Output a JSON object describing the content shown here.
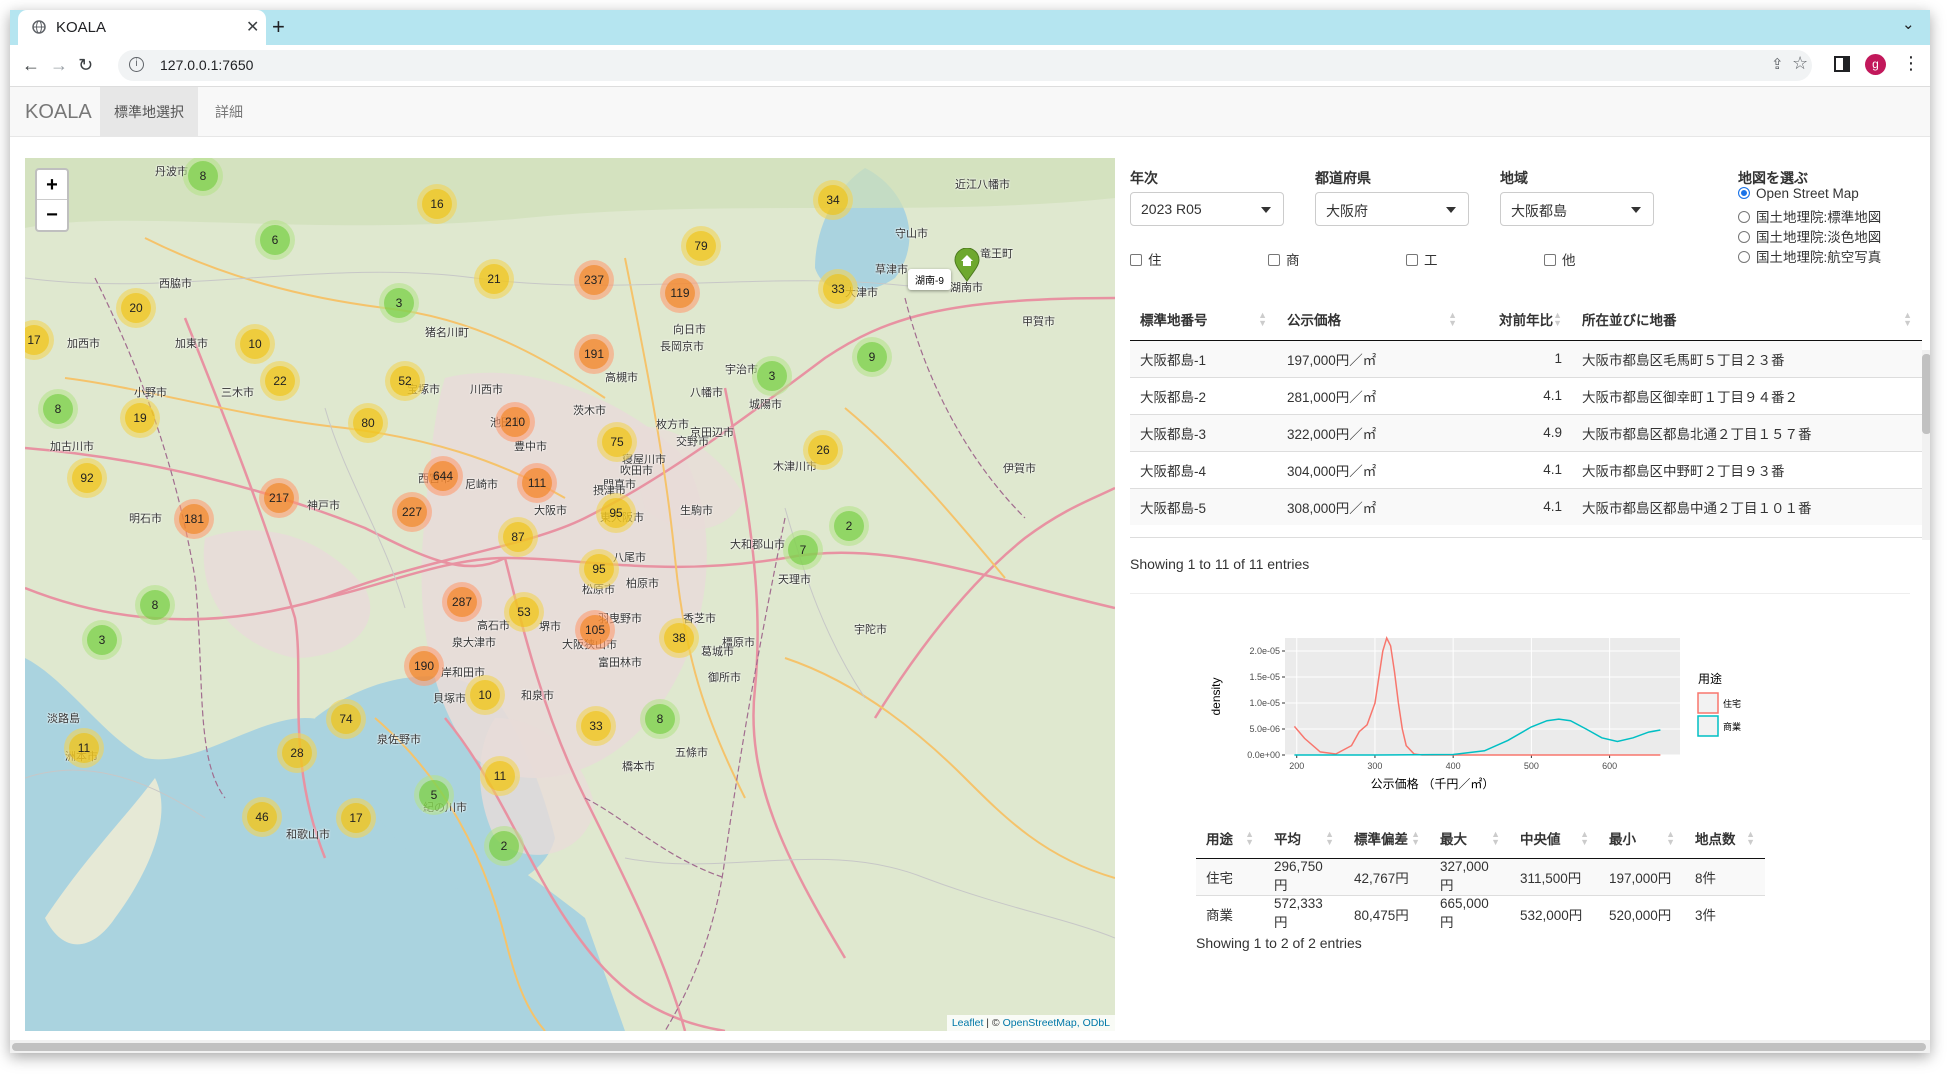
{
  "browser": {
    "tab_title": "KOALA",
    "url": "127.0.0.1:7650",
    "profile_initial": "g"
  },
  "app": {
    "brand": "KOALA",
    "nav": [
      "標準地選択",
      "詳細"
    ]
  },
  "map": {
    "attribution_leaflet": "Leaflet",
    "attribution_sep": " | © ",
    "attribution_osm": "OpenStreetMap",
    "attribution_odbl": ", ODbL",
    "tooltip": "湖南-9",
    "clusters": [
      {
        "n": "8",
        "c": "g"
      },
      {
        "n": "16",
        "c": "y"
      },
      {
        "n": "6",
        "c": "g"
      },
      {
        "n": "20",
        "c": "y"
      },
      {
        "n": "3",
        "c": "g"
      },
      {
        "n": "21",
        "c": "y"
      },
      {
        "n": "237",
        "c": "o"
      },
      {
        "n": "119",
        "c": "o"
      },
      {
        "n": "79",
        "c": "y"
      },
      {
        "n": "34",
        "c": "y"
      },
      {
        "n": "33",
        "c": "y"
      },
      {
        "n": "17",
        "c": "y"
      },
      {
        "n": "10",
        "c": "y"
      },
      {
        "n": "22",
        "c": "y"
      },
      {
        "n": "52",
        "c": "y"
      },
      {
        "n": "191",
        "c": "o"
      },
      {
        "n": "3",
        "c": "g"
      },
      {
        "n": "9",
        "c": "g"
      },
      {
        "n": "8",
        "c": "g"
      },
      {
        "n": "19",
        "c": "y"
      },
      {
        "n": "80",
        "c": "y"
      },
      {
        "n": "210",
        "c": "o"
      },
      {
        "n": "75",
        "c": "y"
      },
      {
        "n": "26",
        "c": "y"
      },
      {
        "n": "92",
        "c": "y"
      },
      {
        "n": "644",
        "c": "o"
      },
      {
        "n": "111",
        "c": "o"
      },
      {
        "n": "217",
        "c": "o"
      },
      {
        "n": "227",
        "c": "o"
      },
      {
        "n": "95",
        "c": "y"
      },
      {
        "n": "181",
        "c": "o"
      },
      {
        "n": "87",
        "c": "y"
      },
      {
        "n": "2",
        "c": "g"
      },
      {
        "n": "7",
        "c": "g"
      },
      {
        "n": "95",
        "c": "y"
      },
      {
        "n": "8",
        "c": "g"
      },
      {
        "n": "287",
        "c": "o"
      },
      {
        "n": "53",
        "c": "y"
      },
      {
        "n": "105",
        "c": "o"
      },
      {
        "n": "38",
        "c": "y"
      },
      {
        "n": "3",
        "c": "g"
      },
      {
        "n": "190",
        "c": "o"
      },
      {
        "n": "10",
        "c": "y"
      },
      {
        "n": "74",
        "c": "y"
      },
      {
        "n": "8",
        "c": "g"
      },
      {
        "n": "33",
        "c": "y"
      },
      {
        "n": "28",
        "c": "y"
      },
      {
        "n": "11",
        "c": "y"
      },
      {
        "n": "11",
        "c": "y"
      },
      {
        "n": "5",
        "c": "g"
      },
      {
        "n": "46",
        "c": "y"
      },
      {
        "n": "17",
        "c": "y"
      },
      {
        "n": "2",
        "c": "g"
      }
    ],
    "places": [
      "丹波市",
      "近江八幡市",
      "守山市",
      "草津市",
      "竜王町",
      "湖南市",
      "大津市",
      "甲賀市",
      "西脇市",
      "加西市",
      "加東市",
      "小野市",
      "三木市",
      "猪名川町",
      "宝塚市",
      "川西市",
      "池田市",
      "豊中市",
      "茨木市",
      "高槻市",
      "長岡京市",
      "向日市",
      "宇治市",
      "八幡市",
      "城陽市",
      "枚方市",
      "交野市",
      "寝屋川市",
      "京田辺市",
      "木津川市",
      "伊賀市",
      "加古川市",
      "明石市",
      "神戸市",
      "西宮市",
      "尼崎市",
      "大阪市",
      "門真市",
      "東大阪市",
      "生駒市",
      "八尾市",
      "大和郡山市",
      "天理市",
      "柏原市",
      "香芝市",
      "橿原市",
      "葛城市",
      "御所市",
      "宇陀市",
      "松原市",
      "堺市",
      "羽曳野市",
      "大阪狭山市",
      "富田林市",
      "泉大津市",
      "岸和田市",
      "和泉市",
      "貝塚市",
      "泉佐野市",
      "五條市",
      "淡路島",
      "洲本市",
      "和歌山市",
      "紀の川市",
      "橋本市",
      "摂津市",
      "吹田市",
      "高石市"
    ]
  },
  "filters": {
    "year_label": "年次",
    "year_value": "2023 R05",
    "pref_label": "都道府県",
    "pref_value": "大阪府",
    "region_label": "地域",
    "region_value": "大阪都島",
    "map_label": "地図を選ぶ",
    "map_options": [
      "Open Street Map",
      "国土地理院:標準地図",
      "国土地理院:淡色地図",
      "国土地理院:航空写真"
    ],
    "map_selected": 0,
    "use_checks": [
      "住",
      "商",
      "工",
      "他"
    ]
  },
  "table1": {
    "headers": [
      "標準地番号",
      "公示価格",
      "対前年比",
      "所在並びに地番"
    ],
    "rows": [
      [
        "大阪都島-1",
        "197,000円／㎡",
        "1",
        "大阪市都島区毛馬町５丁目２３番"
      ],
      [
        "大阪都島-2",
        "281,000円／㎡",
        "4.1",
        "大阪市都島区御幸町１丁目９４番２"
      ],
      [
        "大阪都島-3",
        "322,000円／㎡",
        "4.9",
        "大阪市都島区都島北通２丁目１５７番"
      ],
      [
        "大阪都島-4",
        "304,000円／㎡",
        "4.1",
        "大阪市都島区中野町２丁目９３番"
      ],
      [
        "大阪都島-5",
        "308,000円／㎡",
        "4.1",
        "大阪市都島区都島中通２丁目１０１番"
      ]
    ],
    "info": "Showing 1 to 11 of 11 entries"
  },
  "chart_data": {
    "type": "area",
    "xlabel": "公示価格 （千円／㎡）",
    "ylabel": "density",
    "xticks": [
      "200",
      "300",
      "400",
      "500",
      "600"
    ],
    "yticks": [
      "0.0e+00",
      "5.0e-06",
      "1.0e-05",
      "1.5e-05",
      "2.0e-05"
    ],
    "xlim": [
      185,
      690
    ],
    "ylim": [
      0,
      2.25e-05
    ],
    "legend_title": "用途",
    "series": [
      {
        "name": "住宅",
        "color": "#f8766d",
        "x": [
          197,
          210,
          230,
          250,
          270,
          280,
          290,
          300,
          305,
          310,
          315,
          320,
          325,
          330,
          335,
          340,
          350,
          360,
          380,
          420,
          500,
          600,
          665
        ],
        "y": [
          5.5e-06,
          3.2e-06,
          6e-07,
          2e-07,
          1.8e-06,
          4.5e-06,
          5.8e-06,
          1e-05,
          1.5e-05,
          2e-05,
          2.25e-05,
          2.1e-05,
          1.6e-05,
          1e-05,
          5e-06,
          1.8e-06,
          2e-07,
          0,
          0,
          0,
          0,
          0,
          0
        ]
      },
      {
        "name": "商業",
        "color": "#00bfc4",
        "x": [
          197,
          300,
          400,
          440,
          470,
          500,
          520,
          535,
          550,
          570,
          590,
          610,
          630,
          650,
          665
        ],
        "y": [
          0,
          0,
          1e-07,
          8e-07,
          2.8e-06,
          5.4e-06,
          6.6e-06,
          6.9e-06,
          6.6e-06,
          5e-06,
          3.3e-06,
          2.6e-06,
          3.3e-06,
          4.4e-06,
          4.8e-06
        ]
      }
    ]
  },
  "table2": {
    "headers": [
      "用途",
      "平均",
      "標準偏差",
      "最大",
      "中央値",
      "最小",
      "地点数"
    ],
    "rows": [
      [
        "住宅",
        "296,750円",
        "42,767円",
        "327,000円",
        "311,500円",
        "197,000円",
        "8件"
      ],
      [
        "商業",
        "572,333円",
        "80,475円",
        "665,000円",
        "532,000円",
        "520,000円",
        "3件"
      ]
    ],
    "info": "Showing 1 to 2 of 2 entries"
  }
}
